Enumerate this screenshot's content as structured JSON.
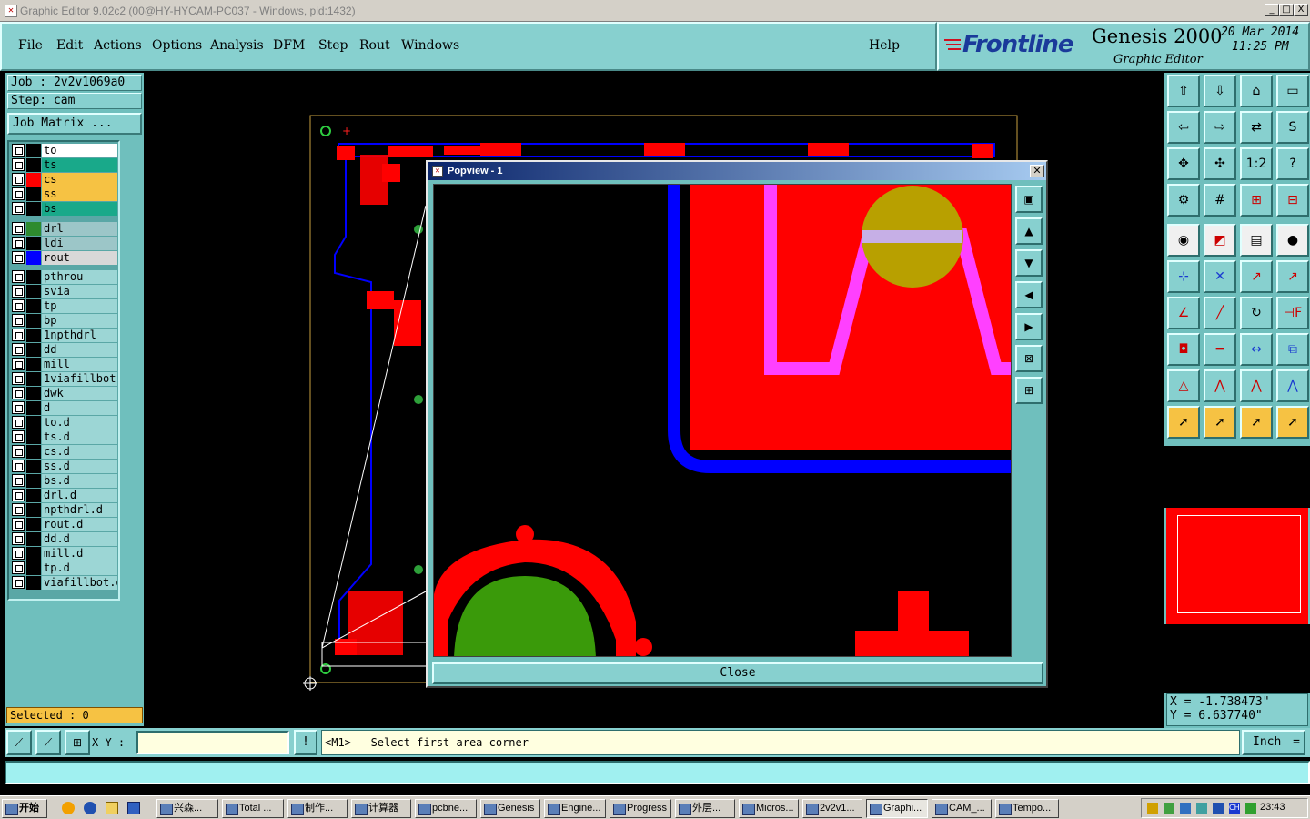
{
  "window": {
    "title": "Graphic Editor 9.02c2 (00@HY-HYCAM-PC037 - Windows, pid:1432)",
    "min": "_",
    "max": "□",
    "close": "X"
  },
  "menu": [
    "File",
    "Edit",
    "Actions",
    "Options",
    "Analysis",
    "DFM",
    "Step",
    "Rout",
    "Windows"
  ],
  "help": "Help",
  "brand": {
    "logo": "Frontline",
    "product": "Genesis 2000",
    "subtitle": "Graphic Editor",
    "date": "20 Mar 2014",
    "time": "11:25 PM"
  },
  "job": {
    "job_line": "Job : 2v2v1069a0",
    "step_line": "Step: cam",
    "matrix_button": "Job Matrix ..."
  },
  "layers": [
    {
      "name": "to",
      "color": "#ffffff",
      "swatch": "#000000"
    },
    {
      "name": "ts",
      "color": "#19a98a",
      "swatch": "#000000"
    },
    {
      "name": "cs",
      "color": "#f6c243",
      "swatch": "#ff0000"
    },
    {
      "name": "ss",
      "color": "#f6c243",
      "swatch": "#000000"
    },
    {
      "name": "bs",
      "color": "#19a98a",
      "swatch": "#000000"
    },
    {
      "name": "drl",
      "color": "#9cc6c8",
      "swatch": "#2e8b2e"
    },
    {
      "name": "ldi",
      "color": "#9cc6c8",
      "swatch": "#000000"
    },
    {
      "name": "rout",
      "color": "#d8d8d8",
      "swatch": "#0000ff"
    },
    {
      "name": "pthrou",
      "color": "#9cd6d5",
      "swatch": "#000000"
    },
    {
      "name": "svia",
      "color": "#9cd6d5",
      "swatch": "#000000"
    },
    {
      "name": "tp",
      "color": "#9cd6d5",
      "swatch": "#000000"
    },
    {
      "name": "bp",
      "color": "#9cd6d5",
      "swatch": "#000000"
    },
    {
      "name": "1npthdrl",
      "color": "#9cd6d5",
      "swatch": "#000000"
    },
    {
      "name": "dd",
      "color": "#9cd6d5",
      "swatch": "#000000"
    },
    {
      "name": "mill",
      "color": "#9cd6d5",
      "swatch": "#000000"
    },
    {
      "name": "1viafillbot",
      "color": "#9cd6d5",
      "swatch": "#000000"
    },
    {
      "name": "dwk",
      "color": "#9cd6d5",
      "swatch": "#000000"
    },
    {
      "name": "d",
      "color": "#9cd6d5",
      "swatch": "#000000"
    },
    {
      "name": "to.d",
      "color": "#9cd6d5",
      "swatch": "#000000"
    },
    {
      "name": "ts.d",
      "color": "#9cd6d5",
      "swatch": "#000000"
    },
    {
      "name": "cs.d",
      "color": "#9cd6d5",
      "swatch": "#000000"
    },
    {
      "name": "ss.d",
      "color": "#9cd6d5",
      "swatch": "#000000"
    },
    {
      "name": "bs.d",
      "color": "#9cd6d5",
      "swatch": "#000000"
    },
    {
      "name": "drl.d",
      "color": "#9cd6d5",
      "swatch": "#000000"
    },
    {
      "name": "npthdrl.d",
      "color": "#9cd6d5",
      "swatch": "#000000"
    },
    {
      "name": "rout.d",
      "color": "#9cd6d5",
      "swatch": "#000000"
    },
    {
      "name": "dd.d",
      "color": "#9cd6d5",
      "swatch": "#000000"
    },
    {
      "name": "mill.d",
      "color": "#9cd6d5",
      "swatch": "#000000"
    },
    {
      "name": "tp.d",
      "color": "#9cd6d5",
      "swatch": "#000000"
    },
    {
      "name": "viafillbot.d",
      "color": "#9cd6d5",
      "swatch": "#000000"
    }
  ],
  "selected": "Selected : 0",
  "popview": {
    "title": "Popview - 1",
    "close_label": "Close"
  },
  "coords": {
    "x": "X = -1.738473\"",
    "y": "Y = 6.637740\""
  },
  "status": {
    "xy_label": "X Y :",
    "xy_value": "",
    "prompt": "<M1> - Select first area corner",
    "units": "Inch"
  },
  "taskbar": {
    "start": "开始",
    "items": [
      "兴森...",
      "Total ...",
      "制作...",
      "计算器",
      "pcbne...",
      "Genesis",
      "Engine...",
      "Progress",
      "外层...",
      "Micros...",
      "2v2v1...",
      "Graphi...",
      "CAM_...",
      "Tempo..."
    ],
    "active_index": 11,
    "clock": "23:43"
  }
}
